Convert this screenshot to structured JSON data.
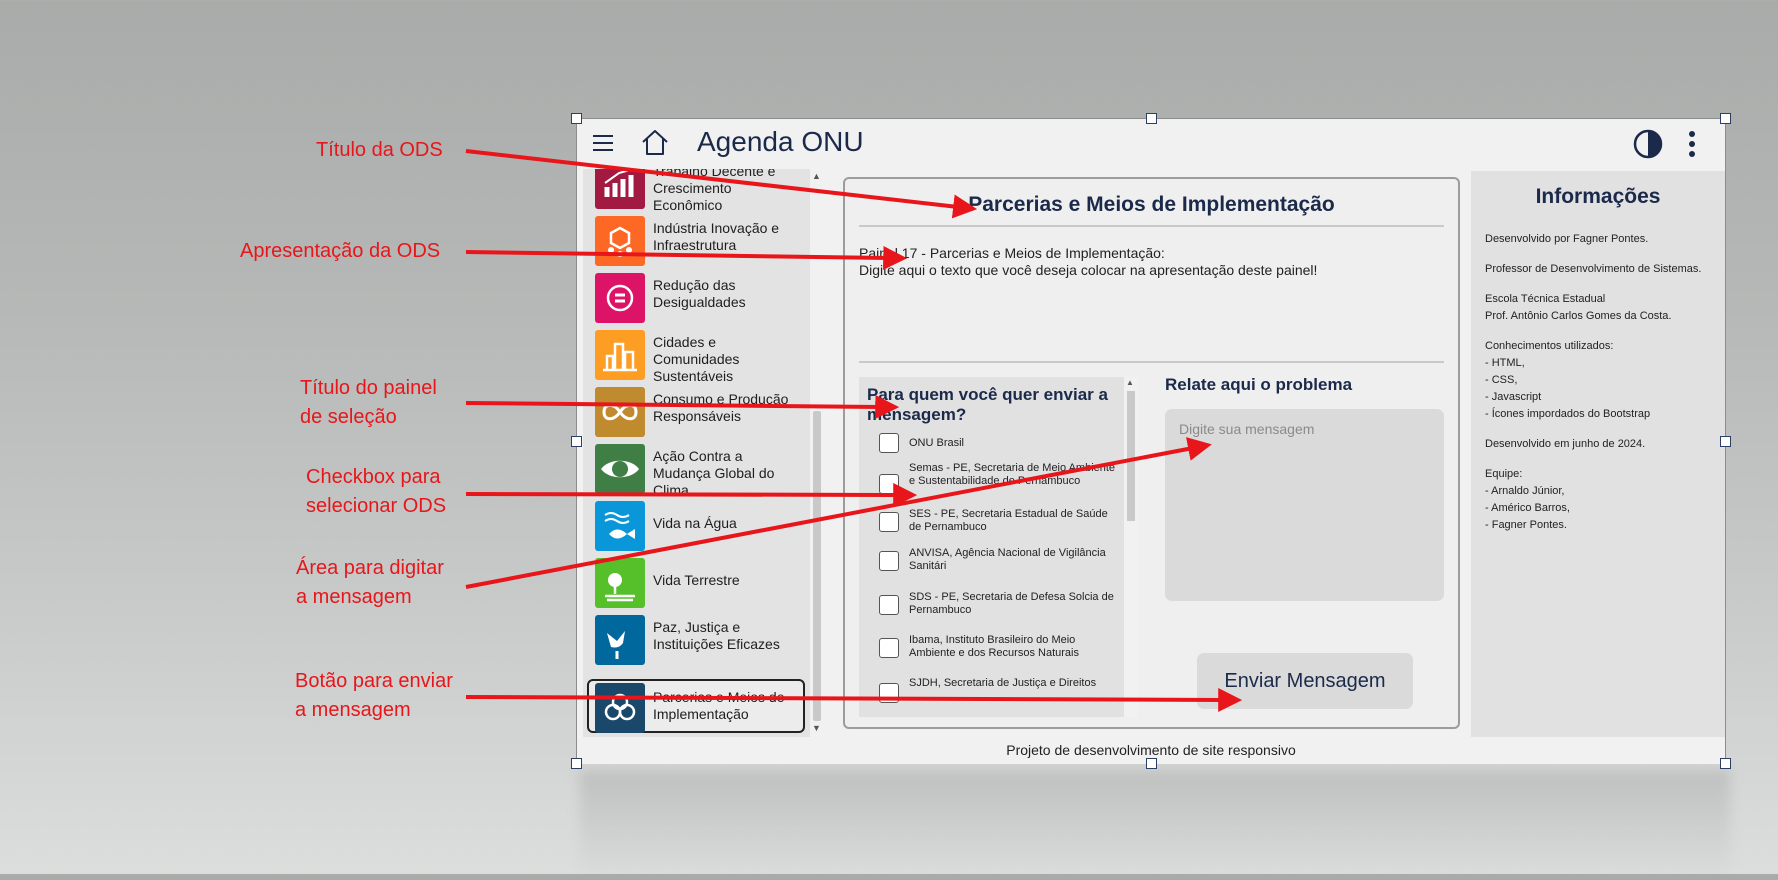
{
  "app": {
    "title": "Agenda ONU"
  },
  "sidebar": {
    "items": [
      {
        "label": "Trabalho Decente e Crescimento Econômico",
        "color": "#a21942",
        "icon": "growth-chart-icon"
      },
      {
        "label": "Indústria Inovação e Infraestrutura",
        "color": "#fd6925",
        "icon": "cubes-icon"
      },
      {
        "label": "Redução das Desigualdades",
        "color": "#dd1367",
        "icon": "equality-icon"
      },
      {
        "label": "Cidades e Comunidades Sustentáveis",
        "color": "#fd9d24",
        "icon": "city-icon"
      },
      {
        "label": "Consumo e Produção Responsáveis",
        "color": "#bf8b2e",
        "icon": "infinity-icon"
      },
      {
        "label": "Ação Contra a Mudança Global do Clima",
        "color": "#3f7e44",
        "icon": "eye-globe-icon"
      },
      {
        "label": "Vida na Água",
        "color": "#0a97d9",
        "icon": "fish-icon"
      },
      {
        "label": "Vida Terrestre",
        "color": "#56c02b",
        "icon": "tree-icon"
      },
      {
        "label": "Paz, Justiça e Instituições Eficazes",
        "color": "#00689d",
        "icon": "dove-icon"
      },
      {
        "label": "Parcerias e Meios de Implementação",
        "color": "#19486a",
        "icon": "rings-icon"
      }
    ]
  },
  "main": {
    "title": "Parcerias e Meios de Implementação",
    "intro_line1": "Painel 17 - Parcerias e Meios de Implementação:",
    "intro_line2": "Digite aqui o texto que você deseja colocar na apresentação deste painel!",
    "select_title": "Para quem você quer enviar a mensagem?",
    "options": [
      "ONU Brasil",
      "Semas - PE, Secretaria de Meio Ambiente e Sustentabilidade de Pernambuco",
      "SES - PE, Secretaria Estadual de Saúde de Pernambuco",
      "ANVISA, Agência Nacional de Vigilância Sanitári",
      "SDS - PE, Secretaria de Defesa Solcia de Pernambuco",
      "Ibama, Instituto Brasileiro do Meio Ambiente e dos Recursos Naturais",
      "SJDH, Secretaria de Justiça e Direitos"
    ],
    "report_title": "Relate aqui o problema",
    "message_placeholder": "Digite sua mensagem",
    "send_label": "Enviar Mensagem"
  },
  "info": {
    "title": "Informações",
    "lines": [
      "Desenvolvido por Fagner Pontes.",
      "Professor de Desenvolvimento de Sistemas.",
      "Escola Técnica Estadual",
      "Prof. Antônio Carlos Gomes da Costa.",
      "Conhecimentos utilizados:",
      "- HTML,",
      "- CSS,",
      "- Javascript",
      "- Ícones impordados do Bootstrap",
      "Desenvolvido em junho de 2024.",
      "Equipe:",
      "- Arnaldo Júnior,",
      "- Américo Barros,",
      "- Fagner Pontes."
    ]
  },
  "footer": {
    "text": "Projeto de desenvolvimento de site responsivo"
  },
  "annotations": {
    "titulo_ods": "Título da ODS",
    "apresentacao_ods": "Apresentação da ODS",
    "titulo_painel_1": "Título do painel",
    "titulo_painel_2": "de seleção",
    "checkbox_1": "Checkbox para",
    "checkbox_2": "selecionar ODS",
    "area_1": "Área para digitar",
    "area_2": "a mensagem",
    "botao_1": "Botão para enviar",
    "botao_2": "a mensagem",
    "color": "#e8161a"
  }
}
